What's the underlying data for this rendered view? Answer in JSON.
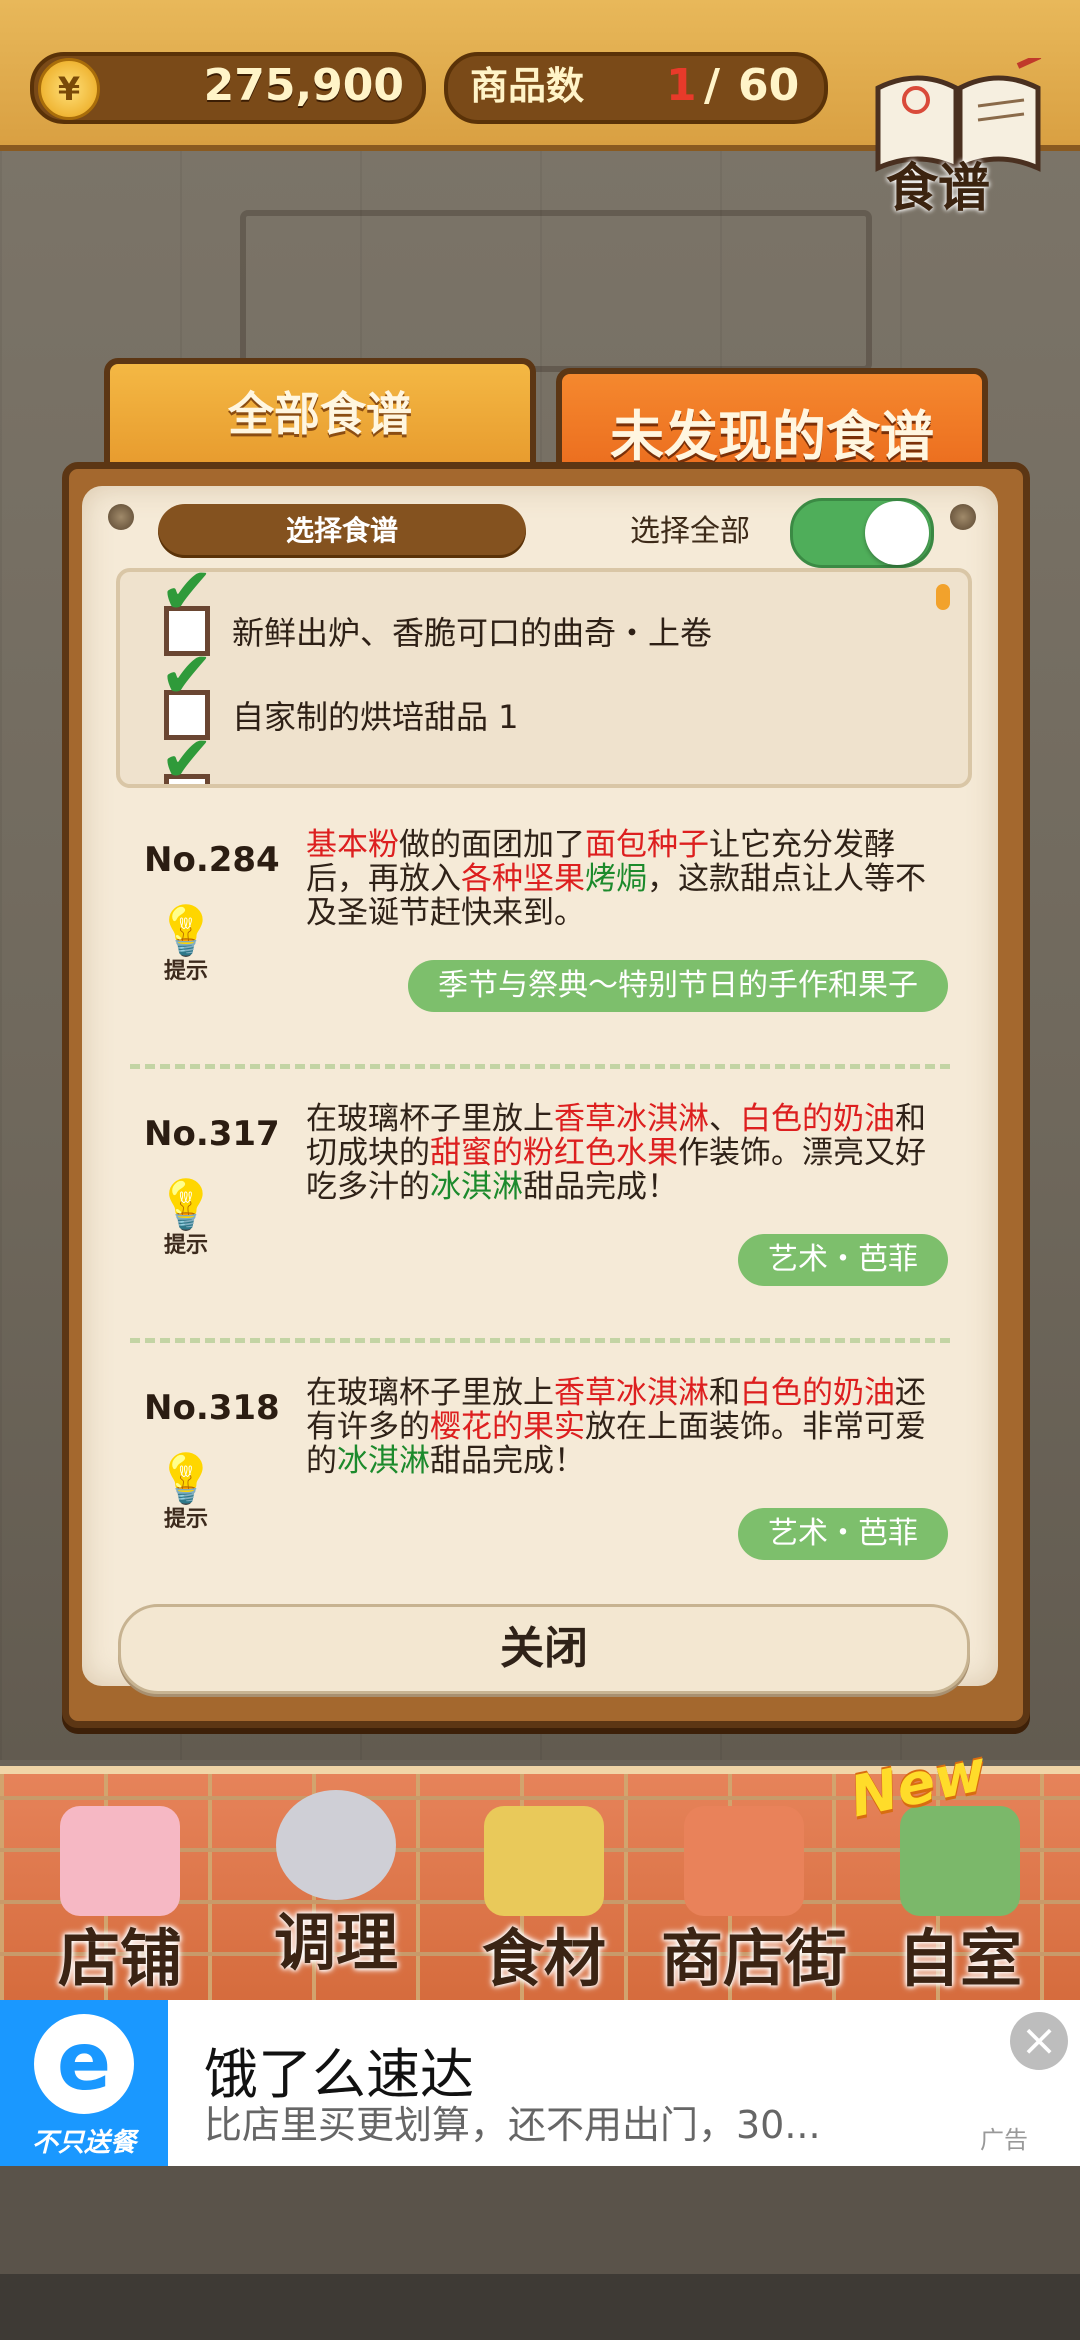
{
  "top_bar": {
    "coin_symbol": "¥",
    "coins": "275,900",
    "product_count_label": "商品数",
    "product_count_current": "1",
    "product_count_sep": "/",
    "product_count_max": "60",
    "recipe_book_label": "食谱"
  },
  "tabs": {
    "all": "全部食谱",
    "undiscovered": "未发现的食谱"
  },
  "panel": {
    "select_recipe": "选择食谱",
    "select_all": "选择全部",
    "select_all_on": true,
    "filters": [
      {
        "label": "新鲜出炉、香脆可口的曲奇・上卷",
        "checked": true
      },
      {
        "label": "自家制的烘培甜品 1",
        "checked": true
      },
      {
        "label": "",
        "checked": true
      }
    ],
    "hint_label": "提示",
    "entries": [
      {
        "no": "No.284",
        "desc": [
          {
            "t": "基本粉",
            "c": "red"
          },
          {
            "t": "做的面团加了",
            "c": ""
          },
          {
            "t": "面包种子",
            "c": "red"
          },
          {
            "t": "让它充分发酵后，再放入",
            "c": ""
          },
          {
            "t": "各种坚果",
            "c": "red"
          },
          {
            "t": "烤焗",
            "c": "green"
          },
          {
            "t": "，这款甜点让人等不及圣诞节赶快来到。",
            "c": ""
          }
        ],
        "tag": "季节与祭典～特别节日的手作和果子"
      },
      {
        "no": "No.317",
        "desc": [
          {
            "t": "在玻璃杯子里放上",
            "c": ""
          },
          {
            "t": "香草冰淇淋",
            "c": "red"
          },
          {
            "t": "、",
            "c": ""
          },
          {
            "t": "白色的奶油",
            "c": "red"
          },
          {
            "t": "和切成块的",
            "c": ""
          },
          {
            "t": "甜蜜的粉红色水果",
            "c": "red"
          },
          {
            "t": "作装饰。漂亮又好吃多汁的",
            "c": ""
          },
          {
            "t": "冰淇淋",
            "c": "green"
          },
          {
            "t": "甜品完成！",
            "c": ""
          }
        ],
        "tag": "艺术・芭菲"
      },
      {
        "no": "No.318",
        "desc": [
          {
            "t": "在玻璃杯子里放上",
            "c": ""
          },
          {
            "t": "香草冰淇淋",
            "c": "red"
          },
          {
            "t": "和",
            "c": ""
          },
          {
            "t": "白色的奶油",
            "c": "red"
          },
          {
            "t": "还有许多的",
            "c": ""
          },
          {
            "t": "樱花的果实",
            "c": "red"
          },
          {
            "t": "放在上面装饰。非常可爱的",
            "c": ""
          },
          {
            "t": "冰淇淋",
            "c": "green"
          },
          {
            "t": "甜品完成！",
            "c": ""
          }
        ],
        "tag": "艺术・芭菲"
      }
    ],
    "close": "关闭"
  },
  "bottom_nav": {
    "new_badge": "New",
    "items": [
      {
        "label": "店铺",
        "icon": "cake-icon",
        "color": "#f6b8c4"
      },
      {
        "label": "调理",
        "icon": "mixing-bowl-icon",
        "color": "#cfcfd6"
      },
      {
        "label": "食材",
        "icon": "flour-sack-icon",
        "color": "#e9c95a"
      },
      {
        "label": "商店街",
        "icon": "shop-street-icon",
        "color": "#e9825a"
      },
      {
        "label": "自室",
        "icon": "staff-only-sign-icon",
        "color": "#7bb86a"
      }
    ]
  },
  "ad": {
    "logo_text": "不只送餐",
    "title": "饿了么速达",
    "subtitle": "比店里买更划算，还不用出门，30...",
    "close": "×",
    "mark": "广告"
  }
}
